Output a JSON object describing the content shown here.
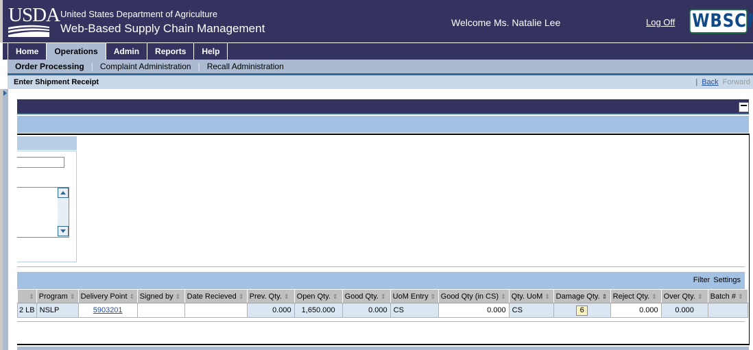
{
  "header": {
    "logo_text": "USDA",
    "org": "United States Department of Agriculture",
    "app_title": "Web-Based Supply Chain Management",
    "welcome": "Welcome Ms. Natalie Lee",
    "logoff": "Log Off",
    "brand_logo": "WBSCM"
  },
  "tabs": [
    {
      "label": "Home"
    },
    {
      "label": "Operations",
      "active": true
    },
    {
      "label": "Admin"
    },
    {
      "label": "Reports"
    },
    {
      "label": "Help"
    }
  ],
  "subnav": [
    {
      "label": "Order Processing",
      "active": true
    },
    {
      "label": "Complaint Administration"
    },
    {
      "label": "Recall Administration"
    }
  ],
  "page": {
    "title": "Enter Shipment Receipt",
    "separator": "|",
    "back": "Back",
    "forward": "Forward"
  },
  "table": {
    "tools": {
      "filter": "Filter",
      "settings": "Settings"
    },
    "sort_icon": "⇕",
    "columns": [
      "",
      "Program",
      "Delivery Point",
      "Signed by",
      "Date Recieved",
      "Prev. Qty.",
      "Open Qty.",
      "Good Qty.",
      "UoM Entry",
      "Good Qty (in CS)",
      "Qty. UoM",
      "Damage Qty.",
      "Reject Qty.",
      "Over Qty.",
      "Batch #"
    ],
    "row": {
      "uom": "2 LB",
      "program": "NSLP",
      "delivery_point": "5903201",
      "signed_by": "",
      "date_received": "",
      "prev_qty": "0.000",
      "open_qty": "1,650.000",
      "good_qty": "0.000",
      "uom_entry": "CS",
      "good_qty_cs": "0.000",
      "qty_uom": "CS",
      "damage_qty": "6",
      "reject_qty": "0.000",
      "over_qty": "0.000",
      "batch": ""
    }
  },
  "colors": {
    "header": "#34325f",
    "nav_light": "#abbad0",
    "accent": "#2f6894",
    "title_bar": "#c9d9e9",
    "table_bar": "#a3c1e3"
  }
}
